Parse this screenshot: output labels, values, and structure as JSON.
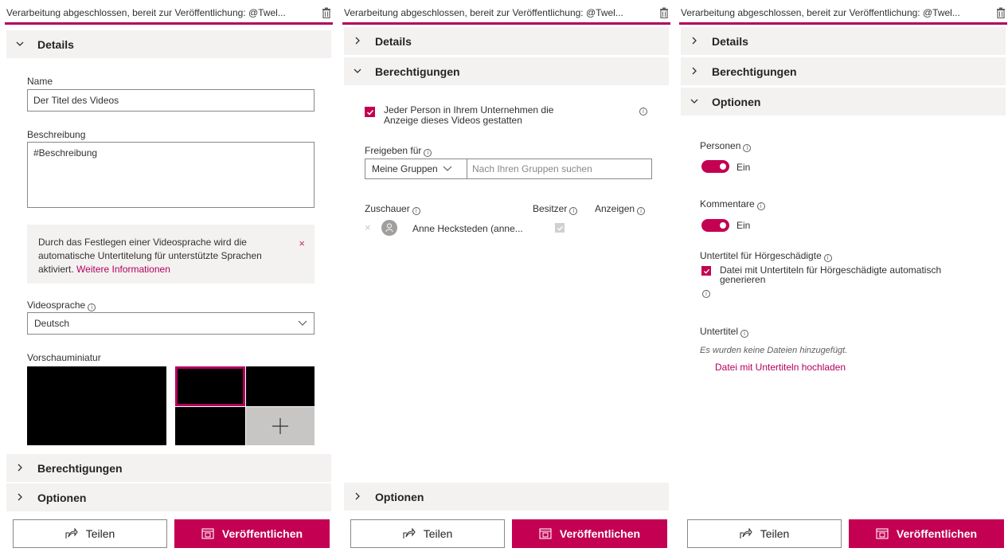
{
  "status_text": "Verarbeitung abgeschlossen, bereit zur Veröffentlichung: @Twel...",
  "icons": {
    "delete": "trash-icon",
    "expand": "chevron-right-icon",
    "collapse": "chevron-down-icon",
    "info": "info-icon",
    "share": "share-icon",
    "publish": "publish-icon",
    "add": "plus-icon",
    "dismiss": "close-icon",
    "avatar": "person-icon"
  },
  "colors": {
    "accent": "#c30052",
    "link": "#b4005e",
    "section_bg": "#f3f2f1"
  },
  "sections": {
    "details": "Details",
    "permissions": "Berechtigungen",
    "options": "Optionen"
  },
  "details": {
    "name_label": "Name",
    "name_value": "Der Titel des Videos",
    "description_label": "Beschreibung",
    "description_value": "#Beschreibung",
    "notice_text": "Durch das Festlegen einer Videosprache wird die automatische Untertitelung für unterstützte Sprachen aktiviert.",
    "notice_link": "Weitere Informationen",
    "notice_close": "×",
    "language_label": "Videosprache",
    "language_value": "Deutsch",
    "thumbnail_label": "Vorschauminiatur",
    "add_glyph": "+"
  },
  "permissions": {
    "allow_all_label": "Jeder Person in Ihrem Unternehmen die Anzeige dieses Videos gestatten",
    "allow_all_checked": true,
    "share_with_label": "Freigeben für",
    "group_select_value": "Meine Gruppen",
    "group_search_placeholder": "Nach Ihren Gruppen suchen",
    "col_viewers": "Zuschauer",
    "col_owner": "Besitzer",
    "col_show": "Anzeigen",
    "viewers": [
      {
        "name": "Anne Hecksteden (anne...",
        "remove": "×"
      }
    ]
  },
  "options": {
    "people_label": "Personen",
    "people_state": "Ein",
    "comments_label": "Kommentare",
    "comments_state": "Ein",
    "captions_label": "Untertitel für Hörgeschädigte",
    "captions_auto_label": "Datei mit Untertiteln für Hörgeschädigte automatisch generieren",
    "captions_auto_checked": true,
    "subtitles_label": "Untertitel",
    "no_files_text": "Es wurden keine Dateien hinzugefügt.",
    "upload_link": "Datei mit Untertiteln hochladen"
  },
  "footer": {
    "share_label": "Teilen",
    "publish_label": "Veröffentlichen"
  },
  "info_glyph": "i"
}
